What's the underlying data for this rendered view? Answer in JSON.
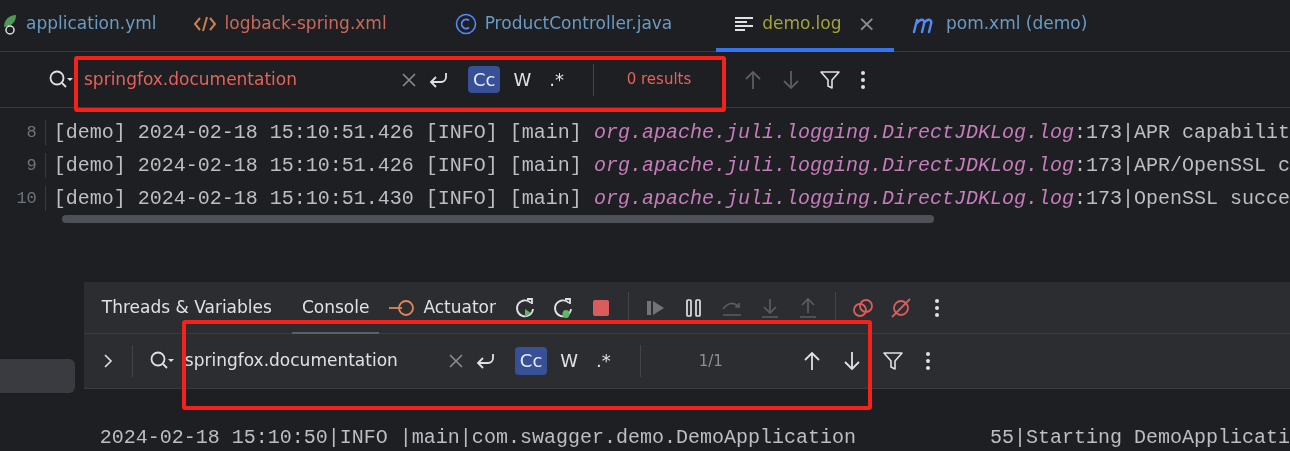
{
  "tabs": [
    {
      "label": "application.yml",
      "kind": "yaml",
      "color": "#6b9bc3",
      "selected": false
    },
    {
      "label": "logback-spring.xml",
      "kind": "xml",
      "color": "#c9695c",
      "selected": false
    },
    {
      "label": "ProductController.java",
      "kind": "class",
      "color": "#6b9bc3",
      "selected": false
    },
    {
      "label": "demo.log",
      "kind": "log",
      "color": "#a3a33a",
      "selected": true,
      "close": "×"
    },
    {
      "label": "pom.xml (demo)",
      "kind": "maven",
      "color": "#6b9bc3",
      "selected": false
    }
  ],
  "editor_search": {
    "highlighted": true,
    "query": "springfox.documentation",
    "found": false,
    "result": "0 results",
    "options": [
      {
        "label": "Cc",
        "selected": true
      },
      {
        "label": "W",
        "selected": false
      },
      {
        "label": ".*",
        "selected": false
      }
    ]
  },
  "log_lines": [
    {
      "number": "8",
      "prefix": "[demo] 2024-02-18 15:10:51.426 [INFO] [main] ",
      "source": "org.apache.juli.logging.DirectJDKLog.log",
      "line": ":173",
      "message": "|APR capabilit"
    },
    {
      "number": "9",
      "prefix": "[demo] 2024-02-18 15:10:51.426 [INFO] [main] ",
      "source": "org.apache.juli.logging.DirectJDKLog.log",
      "line": ":173",
      "message": "|APR/OpenSSL c"
    },
    {
      "number": "10",
      "prefix": "[demo] 2024-02-18 15:10:51.430 [INFO] [main] ",
      "source": "org.apache.juli.logging.DirectJDKLog.log",
      "line": ":173",
      "message": "|OpenSSL succe"
    }
  ],
  "debug_tabs": [
    {
      "label": "Threads & Variables",
      "selected": false
    },
    {
      "label": "Console",
      "selected": true
    },
    {
      "label": "Actuator",
      "selected": false
    }
  ],
  "console_search": {
    "highlighted": true,
    "query": "springfox.documentation",
    "found": true,
    "result": "1/1",
    "options": [
      {
        "label": "Cc",
        "selected": true
      },
      {
        "label": "W",
        "selected": false
      },
      {
        "label": ".*",
        "selected": false
      }
    ]
  },
  "console_lines": [
    {
      "text": "2024-02-18 15:10:50|INFO |main|com.swagger.demo.DemoApplication",
      "line": "55",
      "message": "|Starting DemoApplicati"
    }
  ]
}
